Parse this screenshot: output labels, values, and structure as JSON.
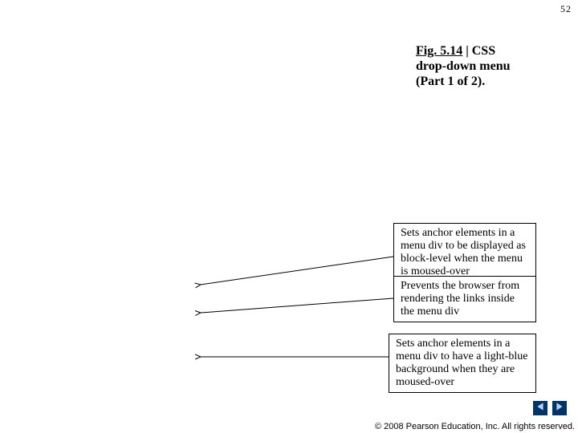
{
  "page_number": "52",
  "caption": {
    "fig_label": "Fig. 5.14",
    "separator": " | ",
    "rest": "CSS drop-down menu (Part 1 of 2)."
  },
  "annotations": {
    "a1": "Sets anchor elements in a menu div to be displayed as block-level when the menu is moused-over",
    "a2": "Prevents the browser from rendering the links inside the menu div",
    "a3": "Sets anchor elements in a menu div to have a light-blue background when they are moused-over"
  },
  "copyright": "© 2008 Pearson Education, Inc. All rights reserved."
}
